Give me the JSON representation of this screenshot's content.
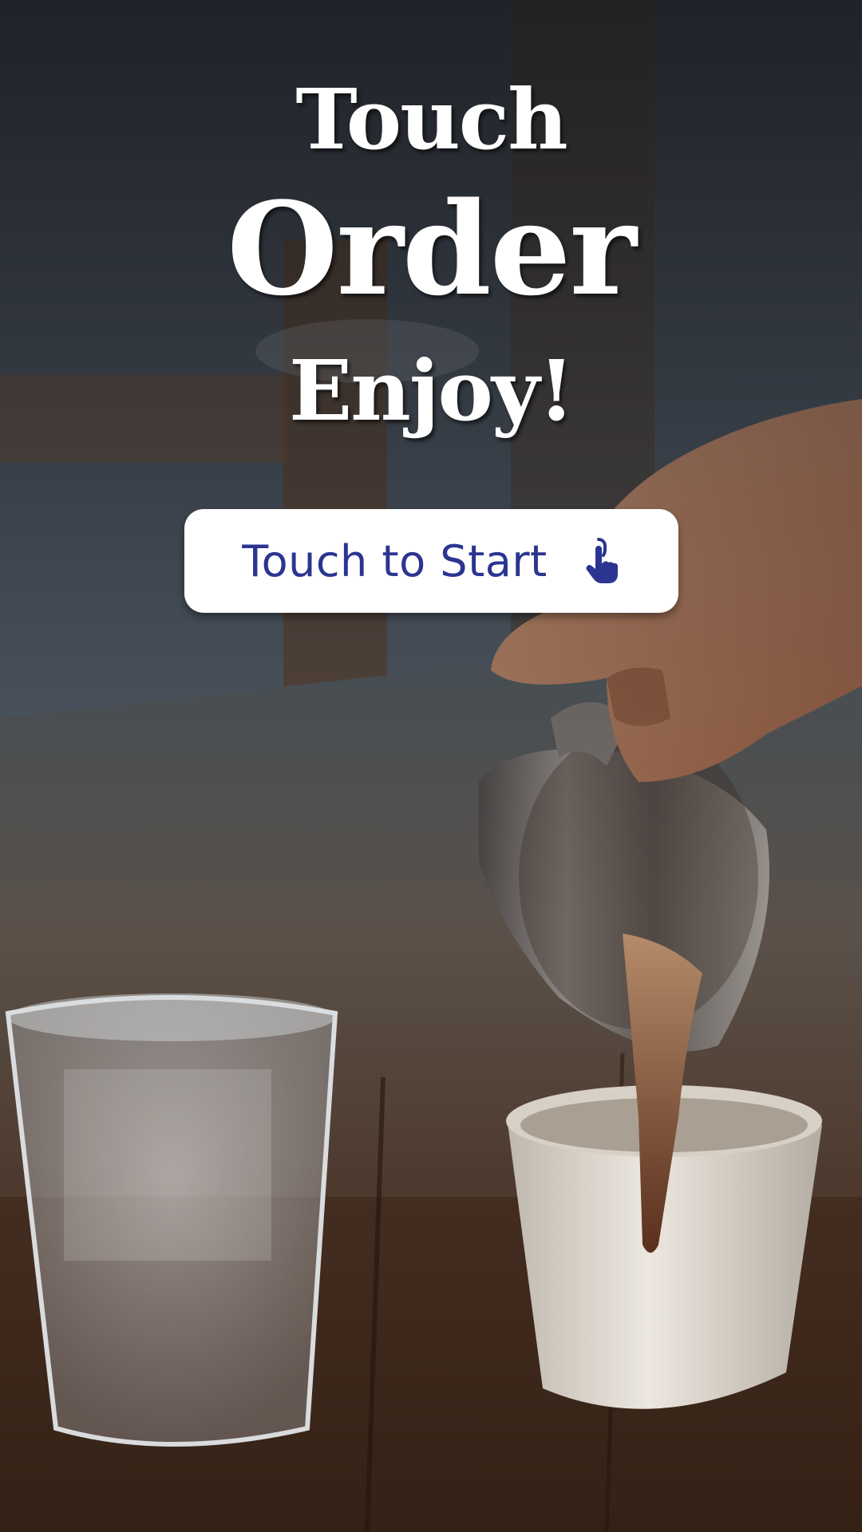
{
  "hero": {
    "line1": "Touch",
    "line2": "Order",
    "line3": "Enjoy!"
  },
  "start_button": {
    "label": "Touch to Start",
    "icon": "tap-hand-icon"
  },
  "background": {
    "image": "photo-barista-pouring-coffee-into-cup-with-glass-of-water"
  },
  "colors": {
    "button_text": "#2b3590",
    "button_bg": "#ffffff",
    "headline_text": "#ffffff"
  }
}
